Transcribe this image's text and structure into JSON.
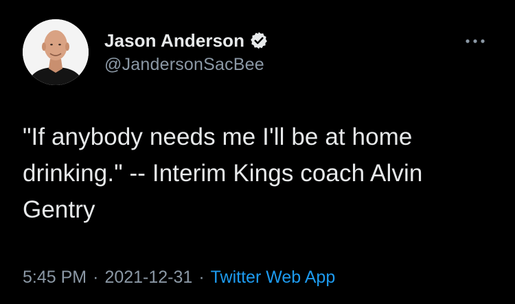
{
  "author": {
    "display_name": "Jason Anderson",
    "handle": "@JandersonSacBee",
    "verified": true
  },
  "tweet": {
    "text": "\"If anybody needs me I'll be at home drinking.\" -- Interim Kings coach Alvin Gentry",
    "time": "5:45 PM",
    "date": "2021-12-31",
    "separator": "·",
    "source": "Twitter Web App"
  },
  "icons": {
    "verified": "verified-badge-icon",
    "more": "more-options-icon"
  },
  "colors": {
    "background": "#000000",
    "primary_text": "#e7e9ea",
    "secondary_text": "#8b98a5",
    "link": "#1d9bf0"
  }
}
